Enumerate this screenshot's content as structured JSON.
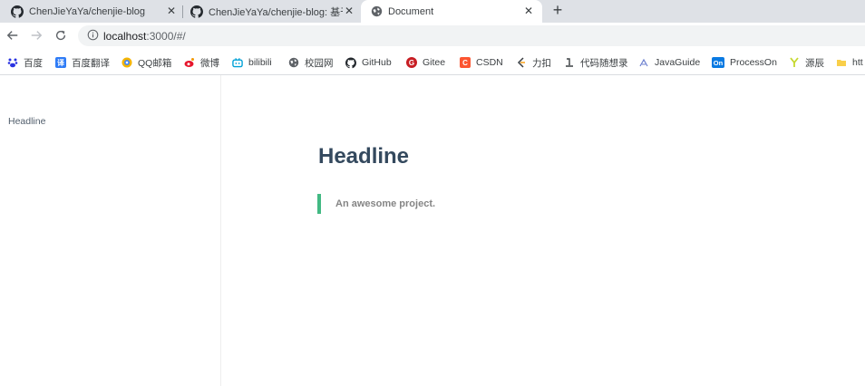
{
  "browser": {
    "tabs": [
      {
        "title": "ChenJieYaYa/chenjie-blog",
        "icon": "github-icon"
      },
      {
        "title": "ChenJieYaYa/chenjie-blog: 基于",
        "icon": "github-icon"
      },
      {
        "title": "Document",
        "icon": "globe-icon"
      }
    ],
    "close_glyph": "✕",
    "new_tab_glyph": "+",
    "address": {
      "host": "localhost",
      "rest": ":3000/#/"
    }
  },
  "bookmarks": [
    {
      "label": "百度",
      "icon": "baidu-icon",
      "color": "#2932e1"
    },
    {
      "label": "百度翻译",
      "icon": "translate-icon",
      "color": "#2f7cf6"
    },
    {
      "label": "QQ邮箱",
      "icon": "qqmail-icon",
      "color": "#f4b400"
    },
    {
      "label": "微博",
      "icon": "weibo-icon",
      "color": "#e6162d"
    },
    {
      "label": "bilibili",
      "icon": "bilibili-icon",
      "color": "#00a1d6"
    },
    {
      "label": "校园网",
      "icon": "globe-icon",
      "color": "#5f6368"
    },
    {
      "label": "GitHub",
      "icon": "github-icon",
      "color": "#24292e"
    },
    {
      "label": "Gitee",
      "icon": "gitee-icon",
      "color": "#c71d23"
    },
    {
      "label": "CSDN",
      "icon": "csdn-icon",
      "color": "#fc5531"
    },
    {
      "label": "力扣",
      "icon": "leetcode-icon",
      "color": "#ffa116"
    },
    {
      "label": "代码随想录",
      "icon": "code-icon",
      "color": "#3c4043"
    },
    {
      "label": "JavaGuide",
      "icon": "javaguide-icon",
      "color": "#6b7fcf"
    },
    {
      "label": "ProcessOn",
      "icon": "processon-icon",
      "color": "#0a7ae2",
      "badge": "On"
    },
    {
      "label": "源辰",
      "icon": "yuanchen-icon",
      "color": "#c6d82f"
    },
    {
      "label": "htt",
      "icon": "folder-icon",
      "color": "#f9cf4a"
    }
  ],
  "page": {
    "sidebar_link": "Headline",
    "headline": "Headline",
    "quote": "An awesome project."
  },
  "colors": {
    "accent": "#42b983",
    "heading": "#34495e"
  }
}
